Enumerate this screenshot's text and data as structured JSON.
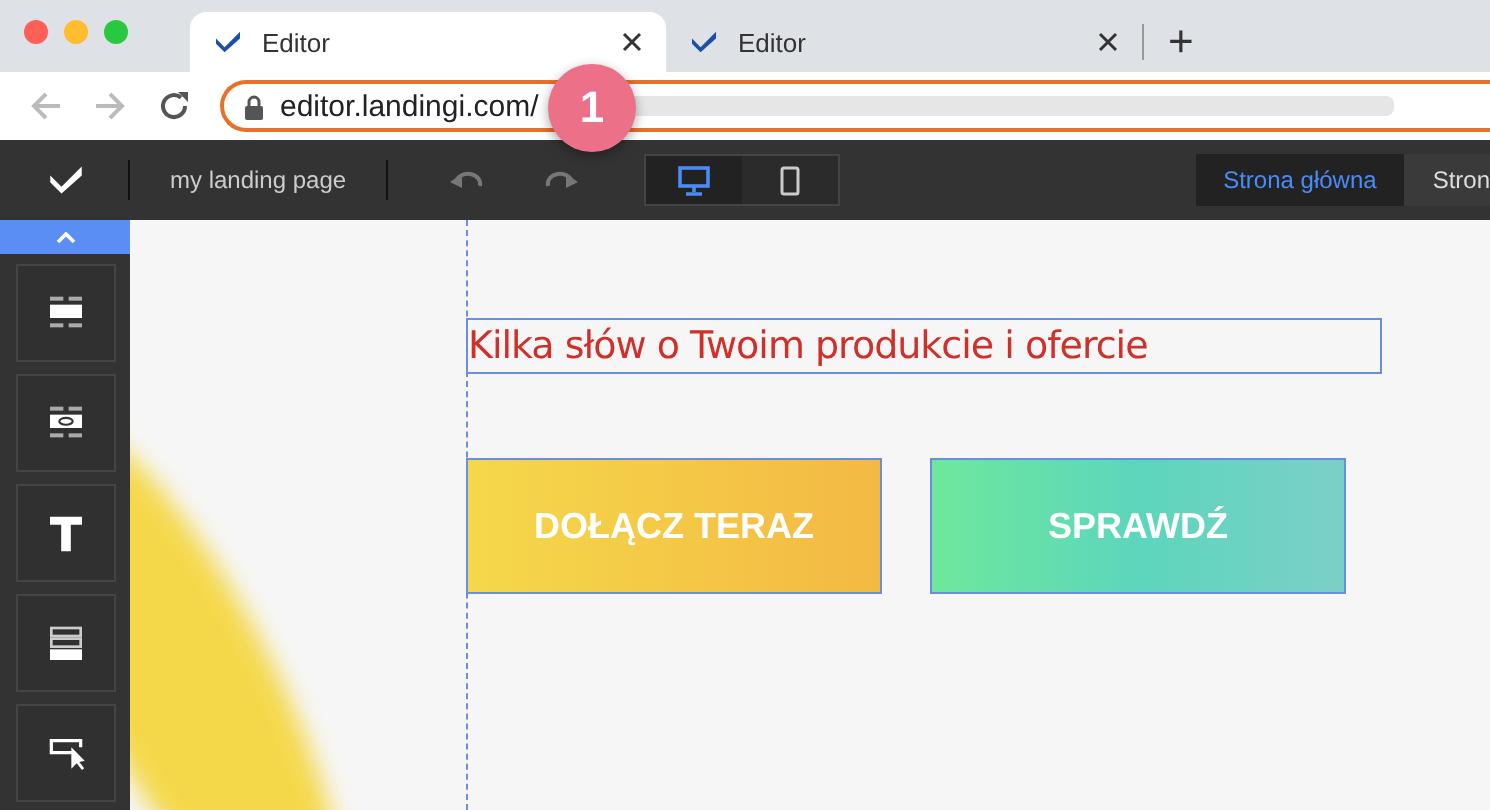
{
  "browser": {
    "tabs": [
      {
        "title": "Editor",
        "selected": true
      },
      {
        "title": "Editor",
        "selected": false
      }
    ],
    "new_tab": "+",
    "url": "editor.landingi.com/",
    "callout": "1"
  },
  "toolbar": {
    "page_name": "my landing page",
    "views": [
      {
        "kind": "desktop",
        "selected": true
      },
      {
        "kind": "mobile",
        "selected": false
      }
    ],
    "pages": [
      {
        "label": "Strona główna",
        "selected": true
      },
      {
        "label": "Stron",
        "selected": false
      }
    ]
  },
  "sidebar": {
    "tools": [
      {
        "kind": "section"
      },
      {
        "kind": "section-link"
      },
      {
        "kind": "text"
      },
      {
        "kind": "rows"
      },
      {
        "kind": "button"
      }
    ]
  },
  "canvas": {
    "heading": "Kilka słów o Twoim produkcie i ofercie",
    "buttons": [
      {
        "label": "DOŁĄCZ TERAZ",
        "kind": "yellow"
      },
      {
        "label": "SPRAWDŹ",
        "kind": "green"
      }
    ]
  }
}
